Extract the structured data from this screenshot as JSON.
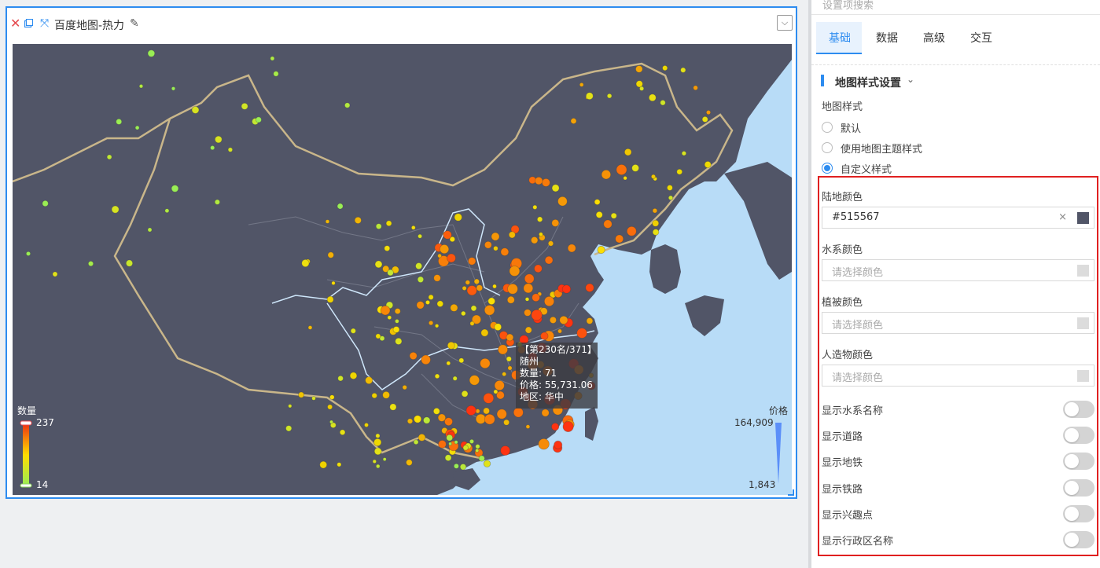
{
  "widget": {
    "title": "百度地图-热力",
    "icons": {
      "close": "close-icon",
      "copy": "copy-icon",
      "expand": "expand-icon",
      "edit": "pencil-icon",
      "dropdown": "chevron-down-icon"
    }
  },
  "map": {
    "land_color": "#515567",
    "water_color": "#b8dcf7",
    "tooltip": {
      "rank": "【第230名/371】",
      "city": "随州",
      "count": "数量: 71",
      "price": "价格: 55,731.06",
      "region": "地区: 华中"
    },
    "color_legend": {
      "title": "数量",
      "max": "237",
      "min": "14",
      "colors": [
        "#ee3311",
        "#ffdd00",
        "#99ee55"
      ]
    },
    "size_legend": {
      "title": "价格",
      "max": "164,909",
      "min": "1,843",
      "color": "#5b8ff9"
    }
  },
  "panel": {
    "search_placeholder": "设置项搜索",
    "tabs": [
      {
        "label": "基础",
        "active": true
      },
      {
        "label": "数据",
        "active": false
      },
      {
        "label": "高级",
        "active": false
      },
      {
        "label": "交互",
        "active": false
      }
    ],
    "section_title": "地图样式设置",
    "map_style_label": "地图样式",
    "radios": [
      {
        "label": "默认",
        "checked": false
      },
      {
        "label": "使用地图主题样式",
        "checked": false
      },
      {
        "label": "自定义样式",
        "checked": true
      }
    ],
    "land": {
      "label": "陆地颜色",
      "value": "#515567",
      "swatch": "#515567",
      "clear": "×"
    },
    "water": {
      "label": "水系颜色",
      "placeholder": "请选择颜色"
    },
    "vegetation": {
      "label": "植被颜色",
      "placeholder": "请选择颜色"
    },
    "manmade": {
      "label": "人造物颜色",
      "placeholder": "请选择颜色"
    },
    "toggles": [
      {
        "label": "显示水系名称",
        "on": false
      },
      {
        "label": "显示道路",
        "on": false
      },
      {
        "label": "显示地铁",
        "on": false
      },
      {
        "label": "显示铁路",
        "on": false
      },
      {
        "label": "显示兴趣点",
        "on": false
      },
      {
        "label": "显示行政区名称",
        "on": false
      }
    ]
  }
}
